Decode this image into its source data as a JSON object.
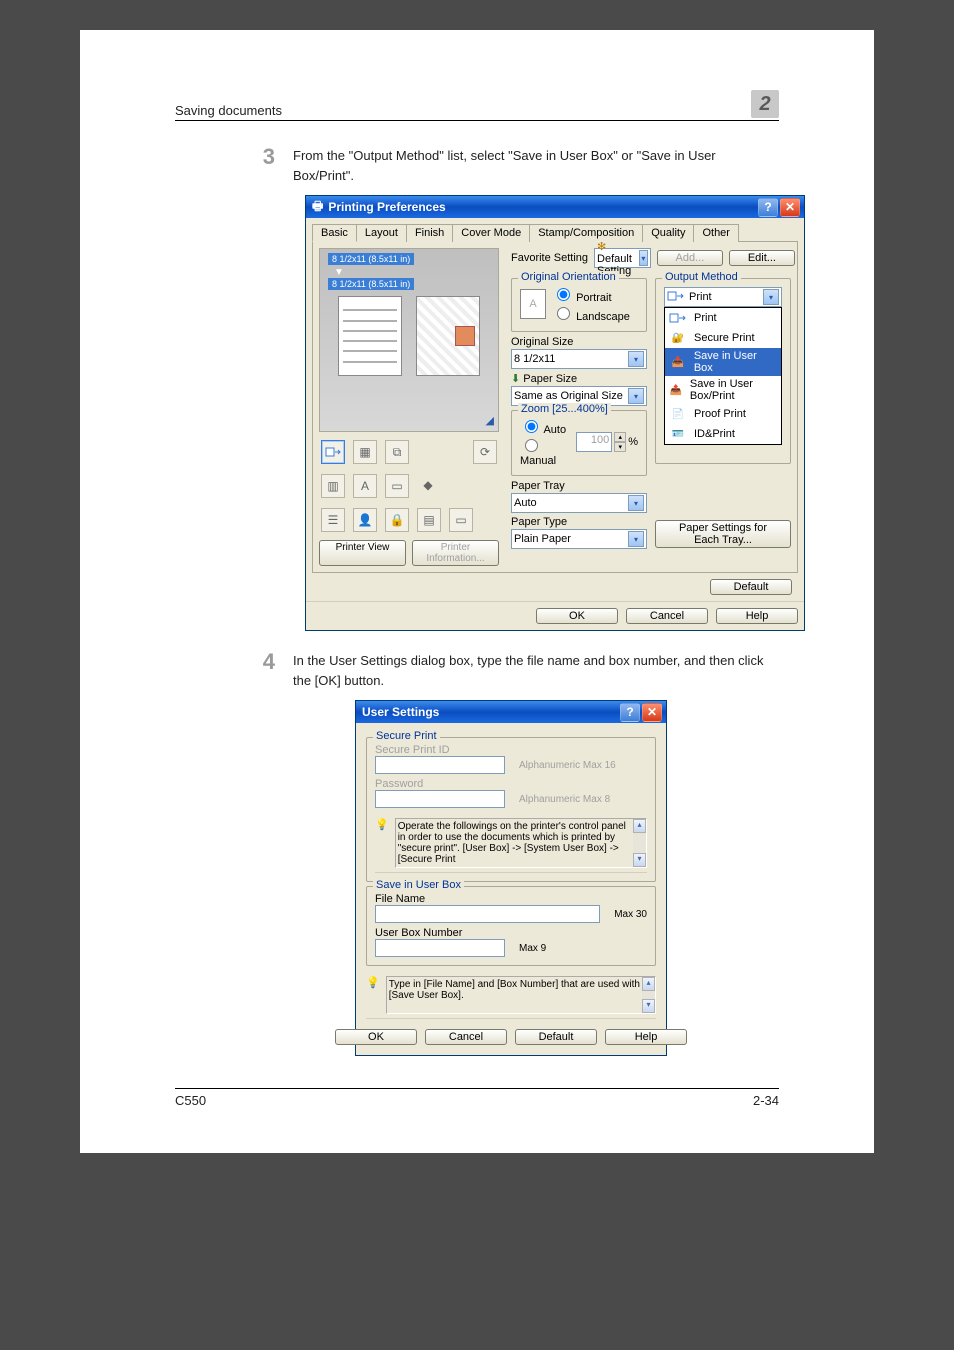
{
  "header": {
    "section_title": "Saving documents",
    "chapter_num": "2"
  },
  "footer": {
    "left": "C550",
    "right": "2-34"
  },
  "step3": {
    "num": "3",
    "text": "From the \"Output Method\" list, select \"Save in User Box\" or \"Save in User Box/Print\"."
  },
  "step4": {
    "num": "4",
    "text": "In the User Settings dialog box, type the file name and box number, and then click the [OK] button."
  },
  "dlg1": {
    "title": "Printing Preferences",
    "tabs": [
      "Basic",
      "Layout",
      "Finish",
      "Cover Mode",
      "Stamp/Composition",
      "Quality",
      "Other"
    ],
    "active_tab": 0,
    "favorite_label": "Favorite Setting",
    "favorite_value": "Default Setting",
    "favorite_icon": "✻",
    "add_btn": "Add...",
    "edit_btn": "Edit...",
    "preview_size1": "8 1/2x11 (8.5x11 in)",
    "preview_size2": "8 1/2x11 (8.5x11 in)",
    "printer_view": "Printer View",
    "printer_info": "Printer Information...",
    "orig_orient": {
      "legend": "Original Orientation",
      "portrait": "Portrait",
      "landscape": "Landscape"
    },
    "orig_size_label": "Original Size",
    "orig_size_value": "8 1/2x11",
    "paper_size_label": "Paper Size",
    "paper_size_value": "Same as Original Size",
    "zoom": {
      "legend": "Zoom [25...400%]",
      "auto": "Auto",
      "manual": "Manual",
      "value": "100",
      "pct": "%"
    },
    "paper_tray_label": "Paper Tray",
    "paper_tray_value": "Auto",
    "paper_type_label": "Paper Type",
    "paper_type_value": "Plain Paper",
    "output_method": {
      "legend": "Output Method",
      "value": "Print",
      "options": [
        "Print",
        "Secure Print",
        "Save in User Box",
        "Save in User Box/Print",
        "Proof Print",
        "ID&Print"
      ],
      "selected_index": 2
    },
    "paper_settings_btn": "Paper Settings for Each Tray...",
    "default_btn": "Default",
    "ok": "OK",
    "cancel": "Cancel",
    "help": "Help"
  },
  "dlg2": {
    "title": "User Settings",
    "secure": {
      "legend": "Secure Print",
      "id_label": "Secure Print ID",
      "id_note": "Alphanumeric Max 16",
      "pw_label": "Password",
      "pw_note": "Alphanumeric Max 8",
      "hint": "Operate the followings on the printer's control panel in order to use the documents which is printed by \"secure print\".\n\n[User Box] -> [System User Box] -> [Secure Print"
    },
    "userbox": {
      "legend": "Save in User Box",
      "file_label": "File Name",
      "file_value": "",
      "file_note": "Max 30",
      "box_label": "User Box Number",
      "box_value": "",
      "box_note": "Max 9"
    },
    "hint2": "Type in [File Name] and [Box Number] that are used with [Save User Box].",
    "ok": "OK",
    "cancel": "Cancel",
    "default": "Default",
    "help": "Help"
  }
}
